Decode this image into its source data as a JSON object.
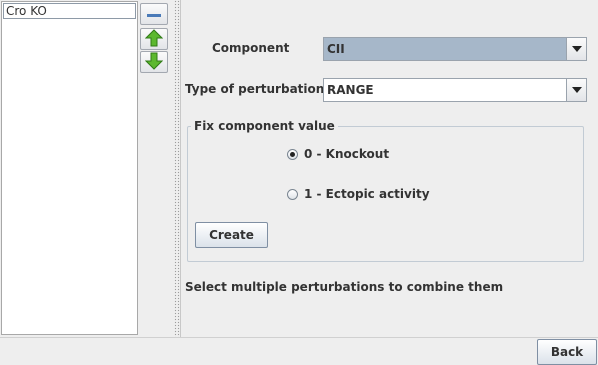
{
  "perturbation_list": {
    "items": [
      "Cro KO"
    ]
  },
  "list_buttons": {
    "remove_icon": "minus-icon",
    "move_up_icon": "green-arrow-up-icon",
    "move_down_icon": "green-arrow-down-icon"
  },
  "form": {
    "component_label": "Component",
    "component_value": "CII",
    "type_label": "Type of perturbation",
    "type_value": "RANGE",
    "fix_group_title": "Fix component value",
    "options": [
      {
        "label": "0 - Knockout",
        "checked": true
      },
      {
        "label": "1 - Ectopic activity",
        "checked": false
      }
    ],
    "create_label": "Create",
    "hint": "Select multiple perturbations to combine them"
  },
  "footer": {
    "back_label": "Back"
  },
  "colors": {
    "selected_combo": "#a6b7c9",
    "arrow_green": "#5cb82e"
  }
}
